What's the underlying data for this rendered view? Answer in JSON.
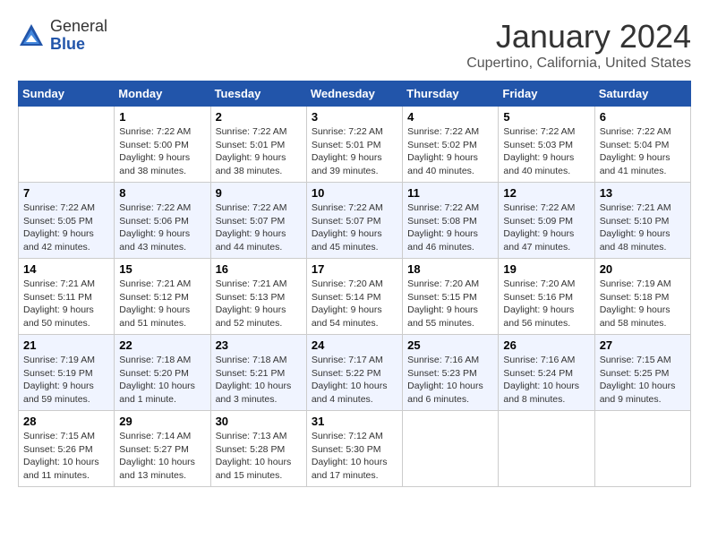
{
  "logo": {
    "general": "General",
    "blue": "Blue"
  },
  "title": "January 2024",
  "location": "Cupertino, California, United States",
  "headers": [
    "Sunday",
    "Monday",
    "Tuesday",
    "Wednesday",
    "Thursday",
    "Friday",
    "Saturday"
  ],
  "weeks": [
    [
      {
        "day": "",
        "sunrise": "",
        "sunset": "",
        "daylight": ""
      },
      {
        "day": "1",
        "sunrise": "Sunrise: 7:22 AM",
        "sunset": "Sunset: 5:00 PM",
        "daylight": "Daylight: 9 hours and 38 minutes."
      },
      {
        "day": "2",
        "sunrise": "Sunrise: 7:22 AM",
        "sunset": "Sunset: 5:01 PM",
        "daylight": "Daylight: 9 hours and 38 minutes."
      },
      {
        "day": "3",
        "sunrise": "Sunrise: 7:22 AM",
        "sunset": "Sunset: 5:01 PM",
        "daylight": "Daylight: 9 hours and 39 minutes."
      },
      {
        "day": "4",
        "sunrise": "Sunrise: 7:22 AM",
        "sunset": "Sunset: 5:02 PM",
        "daylight": "Daylight: 9 hours and 40 minutes."
      },
      {
        "day": "5",
        "sunrise": "Sunrise: 7:22 AM",
        "sunset": "Sunset: 5:03 PM",
        "daylight": "Daylight: 9 hours and 40 minutes."
      },
      {
        "day": "6",
        "sunrise": "Sunrise: 7:22 AM",
        "sunset": "Sunset: 5:04 PM",
        "daylight": "Daylight: 9 hours and 41 minutes."
      }
    ],
    [
      {
        "day": "7",
        "sunrise": "Sunrise: 7:22 AM",
        "sunset": "Sunset: 5:05 PM",
        "daylight": "Daylight: 9 hours and 42 minutes."
      },
      {
        "day": "8",
        "sunrise": "Sunrise: 7:22 AM",
        "sunset": "Sunset: 5:06 PM",
        "daylight": "Daylight: 9 hours and 43 minutes."
      },
      {
        "day": "9",
        "sunrise": "Sunrise: 7:22 AM",
        "sunset": "Sunset: 5:07 PM",
        "daylight": "Daylight: 9 hours and 44 minutes."
      },
      {
        "day": "10",
        "sunrise": "Sunrise: 7:22 AM",
        "sunset": "Sunset: 5:07 PM",
        "daylight": "Daylight: 9 hours and 45 minutes."
      },
      {
        "day": "11",
        "sunrise": "Sunrise: 7:22 AM",
        "sunset": "Sunset: 5:08 PM",
        "daylight": "Daylight: 9 hours and 46 minutes."
      },
      {
        "day": "12",
        "sunrise": "Sunrise: 7:22 AM",
        "sunset": "Sunset: 5:09 PM",
        "daylight": "Daylight: 9 hours and 47 minutes."
      },
      {
        "day": "13",
        "sunrise": "Sunrise: 7:21 AM",
        "sunset": "Sunset: 5:10 PM",
        "daylight": "Daylight: 9 hours and 48 minutes."
      }
    ],
    [
      {
        "day": "14",
        "sunrise": "Sunrise: 7:21 AM",
        "sunset": "Sunset: 5:11 PM",
        "daylight": "Daylight: 9 hours and 50 minutes."
      },
      {
        "day": "15",
        "sunrise": "Sunrise: 7:21 AM",
        "sunset": "Sunset: 5:12 PM",
        "daylight": "Daylight: 9 hours and 51 minutes."
      },
      {
        "day": "16",
        "sunrise": "Sunrise: 7:21 AM",
        "sunset": "Sunset: 5:13 PM",
        "daylight": "Daylight: 9 hours and 52 minutes."
      },
      {
        "day": "17",
        "sunrise": "Sunrise: 7:20 AM",
        "sunset": "Sunset: 5:14 PM",
        "daylight": "Daylight: 9 hours and 54 minutes."
      },
      {
        "day": "18",
        "sunrise": "Sunrise: 7:20 AM",
        "sunset": "Sunset: 5:15 PM",
        "daylight": "Daylight: 9 hours and 55 minutes."
      },
      {
        "day": "19",
        "sunrise": "Sunrise: 7:20 AM",
        "sunset": "Sunset: 5:16 PM",
        "daylight": "Daylight: 9 hours and 56 minutes."
      },
      {
        "day": "20",
        "sunrise": "Sunrise: 7:19 AM",
        "sunset": "Sunset: 5:18 PM",
        "daylight": "Daylight: 9 hours and 58 minutes."
      }
    ],
    [
      {
        "day": "21",
        "sunrise": "Sunrise: 7:19 AM",
        "sunset": "Sunset: 5:19 PM",
        "daylight": "Daylight: 9 hours and 59 minutes."
      },
      {
        "day": "22",
        "sunrise": "Sunrise: 7:18 AM",
        "sunset": "Sunset: 5:20 PM",
        "daylight": "Daylight: 10 hours and 1 minute."
      },
      {
        "day": "23",
        "sunrise": "Sunrise: 7:18 AM",
        "sunset": "Sunset: 5:21 PM",
        "daylight": "Daylight: 10 hours and 3 minutes."
      },
      {
        "day": "24",
        "sunrise": "Sunrise: 7:17 AM",
        "sunset": "Sunset: 5:22 PM",
        "daylight": "Daylight: 10 hours and 4 minutes."
      },
      {
        "day": "25",
        "sunrise": "Sunrise: 7:16 AM",
        "sunset": "Sunset: 5:23 PM",
        "daylight": "Daylight: 10 hours and 6 minutes."
      },
      {
        "day": "26",
        "sunrise": "Sunrise: 7:16 AM",
        "sunset": "Sunset: 5:24 PM",
        "daylight": "Daylight: 10 hours and 8 minutes."
      },
      {
        "day": "27",
        "sunrise": "Sunrise: 7:15 AM",
        "sunset": "Sunset: 5:25 PM",
        "daylight": "Daylight: 10 hours and 9 minutes."
      }
    ],
    [
      {
        "day": "28",
        "sunrise": "Sunrise: 7:15 AM",
        "sunset": "Sunset: 5:26 PM",
        "daylight": "Daylight: 10 hours and 11 minutes."
      },
      {
        "day": "29",
        "sunrise": "Sunrise: 7:14 AM",
        "sunset": "Sunset: 5:27 PM",
        "daylight": "Daylight: 10 hours and 13 minutes."
      },
      {
        "day": "30",
        "sunrise": "Sunrise: 7:13 AM",
        "sunset": "Sunset: 5:28 PM",
        "daylight": "Daylight: 10 hours and 15 minutes."
      },
      {
        "day": "31",
        "sunrise": "Sunrise: 7:12 AM",
        "sunset": "Sunset: 5:30 PM",
        "daylight": "Daylight: 10 hours and 17 minutes."
      },
      {
        "day": "",
        "sunrise": "",
        "sunset": "",
        "daylight": ""
      },
      {
        "day": "",
        "sunrise": "",
        "sunset": "",
        "daylight": ""
      },
      {
        "day": "",
        "sunrise": "",
        "sunset": "",
        "daylight": ""
      }
    ]
  ]
}
